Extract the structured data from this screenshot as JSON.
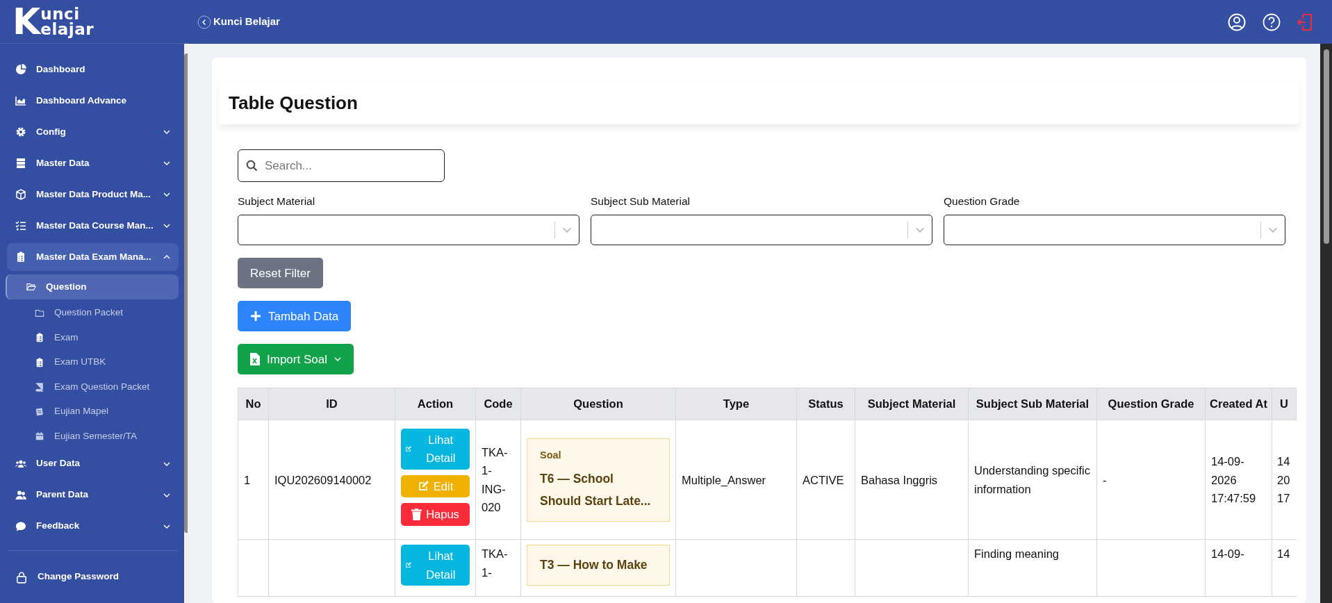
{
  "logo": {
    "mark": "K",
    "lines": [
      "unci",
      "elajar"
    ]
  },
  "topbar": {
    "title": "Kunci Belajar"
  },
  "sidebar": {
    "items": [
      {
        "label": "Dashboard"
      },
      {
        "label": "Dashboard Advance"
      },
      {
        "label": "Config",
        "expanded": false
      },
      {
        "label": "Master Data",
        "expanded": false
      },
      {
        "label": "Master Data Product Ma...",
        "expanded": false
      },
      {
        "label": "Master Data Course Man...",
        "expanded": false
      },
      {
        "label": "Master Data Exam Mana...",
        "expanded": true,
        "children": [
          {
            "label": "Question",
            "selected": true
          },
          {
            "label": "Question Packet",
            "selected": false
          },
          {
            "label": "Exam",
            "selected": false
          },
          {
            "label": "Exam UTBK",
            "selected": false
          },
          {
            "label": "Exam Question Packet",
            "selected": false
          },
          {
            "label": "Eujian Mapel",
            "selected": false
          },
          {
            "label": "Eujian Semester/TA",
            "selected": false
          }
        ]
      },
      {
        "label": "User Data",
        "expanded": false
      },
      {
        "label": "Parent Data",
        "expanded": false
      },
      {
        "label": "Feedback",
        "expanded": false
      }
    ],
    "footer_items": [
      {
        "label": "Change Password"
      }
    ]
  },
  "page_title": "Table Question",
  "search": {
    "placeholder": "Search..."
  },
  "filters": [
    {
      "label": "Subject Material"
    },
    {
      "label": "Subject Sub Material"
    },
    {
      "label": "Question Grade"
    }
  ],
  "buttons": [
    {
      "label": "Reset Filter",
      "kind": "reset"
    },
    {
      "label": "Tambah Data",
      "kind": "add"
    },
    {
      "label": "Import Soal",
      "kind": "import"
    }
  ],
  "table": {
    "columns": [
      "No",
      "ID",
      "Action",
      "Code",
      "Question",
      "Type",
      "Status",
      "Subject Material",
      "Subject Sub Material",
      "Question Grade",
      "Created At",
      "U"
    ],
    "rows": [
      {
        "no": "1",
        "id": "IQU202609140002",
        "actions": [
          {
            "label": "Lihat Detail",
            "kind": "detail"
          },
          {
            "label": "Edit",
            "kind": "edit"
          },
          {
            "label": "Hapus",
            "kind": "delete"
          }
        ],
        "code": "TKA-1-ING-020",
        "question": {
          "label": "Soal",
          "title": "T6 — School Should Start Late..."
        },
        "type": "Multiple_Answer",
        "status": "ACTIVE",
        "subject_material": "Bahasa Inggris",
        "subject_sub_material": "Understanding specific information",
        "question_grade": "-",
        "created_at": "14-09-2026 17:47:59",
        "column_12": "14 20 17"
      },
      {
        "actions": [
          {
            "label": "Lihat Detail",
            "kind": "detail"
          }
        ],
        "code": "TKA-1-",
        "question": {
          "title": "T3 — How to Make"
        },
        "subject_sub_material": "Finding meaning",
        "created_at": "14-09-",
        "column_12": "14"
      }
    ]
  }
}
